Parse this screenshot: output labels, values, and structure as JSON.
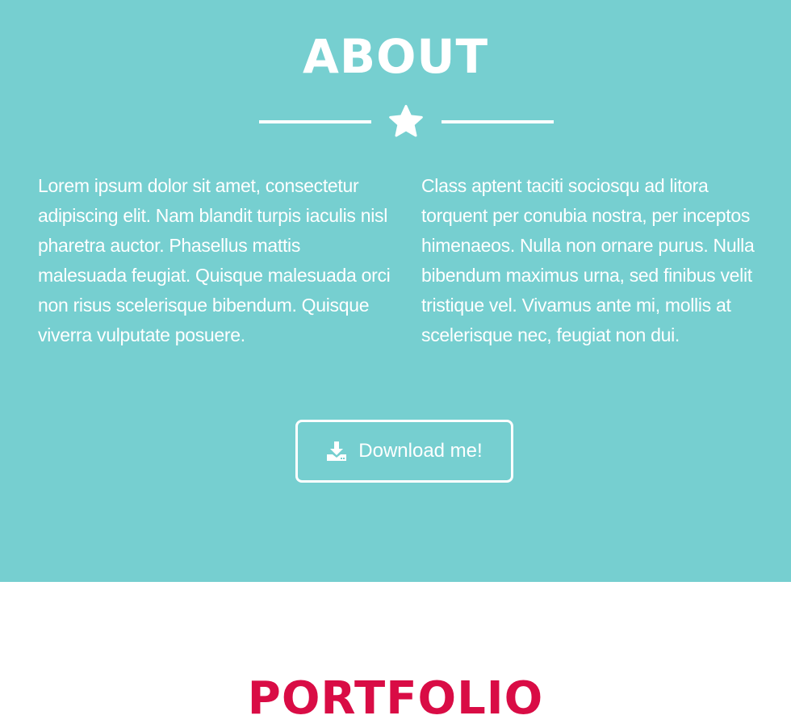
{
  "about": {
    "title": "ABOUT",
    "background_color": "#76cfd0",
    "divider_icon": "star-icon",
    "paragraph_left": "Lorem ipsum dolor sit amet, consectetur adipiscing elit. Nam blandit turpis iaculis nisl pharetra auctor. Phasellus mattis malesuada feugiat. Quisque malesuada orci non risus scelerisque bibendum. Quisque viverra vulputate posuere.",
    "paragraph_right": "Class aptent taciti sociosqu ad litora torquent per conubia nostra, per inceptos himenaeos. Nulla non ornare purus. Nulla bibendum maximus urna, sed finibus velit tristique vel. Vivamus ante mi, mollis at scelerisque nec, feugiat non dui.",
    "download_button": {
      "label": "Download me!",
      "icon": "download-icon"
    }
  },
  "portfolio": {
    "title": "PORTFOLIO",
    "title_color": "#d90c45"
  }
}
